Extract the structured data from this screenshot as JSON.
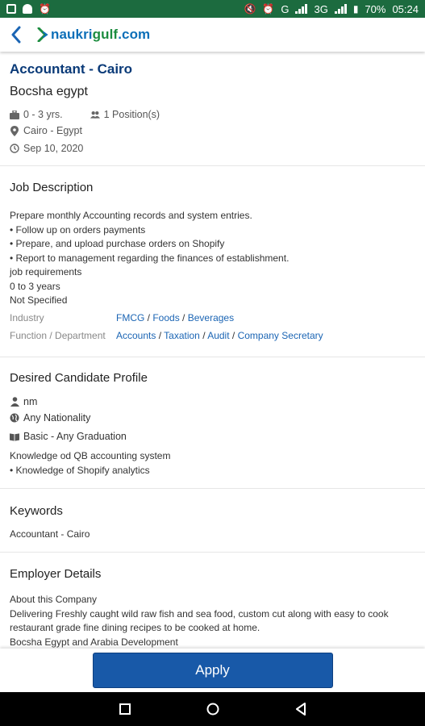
{
  "status_bar": {
    "battery": "70%",
    "time": "05:24",
    "network": "G",
    "network2": "3G"
  },
  "app_bar": {
    "logo_part1": "naukri",
    "logo_part2": "gulf",
    "logo_part3": ".com"
  },
  "job": {
    "title": "Accountant - Cairo",
    "company": "Bocsha egypt",
    "experience": "0 - 3 yrs.",
    "positions": "1 Position(s)",
    "location": "Cairo - Egypt",
    "date": "Sep 10, 2020"
  },
  "job_description": {
    "heading": "Job Description",
    "lines": [
      "Prepare monthly Accounting records and system entries.",
      "• Follow up on orders payments",
      "• Prepare, and upload purchase orders on Shopify",
      "• Report to management regarding the finances of establishment.",
      "job requirements",
      "0 to 3 years",
      "Not Specified"
    ],
    "industry_label": "Industry",
    "industry": [
      "FMCG",
      "Foods",
      "Beverages"
    ],
    "function_label": "Function / Department",
    "function": [
      "Accounts",
      "Taxation",
      "Audit",
      "Company Secretary"
    ],
    "separator": " / "
  },
  "candidate_profile": {
    "heading": "Desired Candidate Profile",
    "gender": "nm",
    "nationality": "Any Nationality",
    "education": "Basic - Any Graduation",
    "lines": [
      "Knowledge od QB accounting system",
      "• Knowledge of Shopify analytics"
    ]
  },
  "keywords": {
    "heading": "Keywords",
    "value": "Accountant - Cairo"
  },
  "employer": {
    "heading": "Employer Details",
    "about_label": "About this Company",
    "description": "Delivering Freshly caught wild raw fish and sea food, custom cut along with easy to cook restaurant grade fine dining recipes to be cooked at home.",
    "cutoff_line": "Bocsha Egypt and Arabia Development"
  },
  "apply_label": "Apply",
  "colors": {
    "status_bar": "#1c6b3f",
    "title": "#0a3a78",
    "link": "#1b65b4",
    "apply": "#1859a8"
  }
}
